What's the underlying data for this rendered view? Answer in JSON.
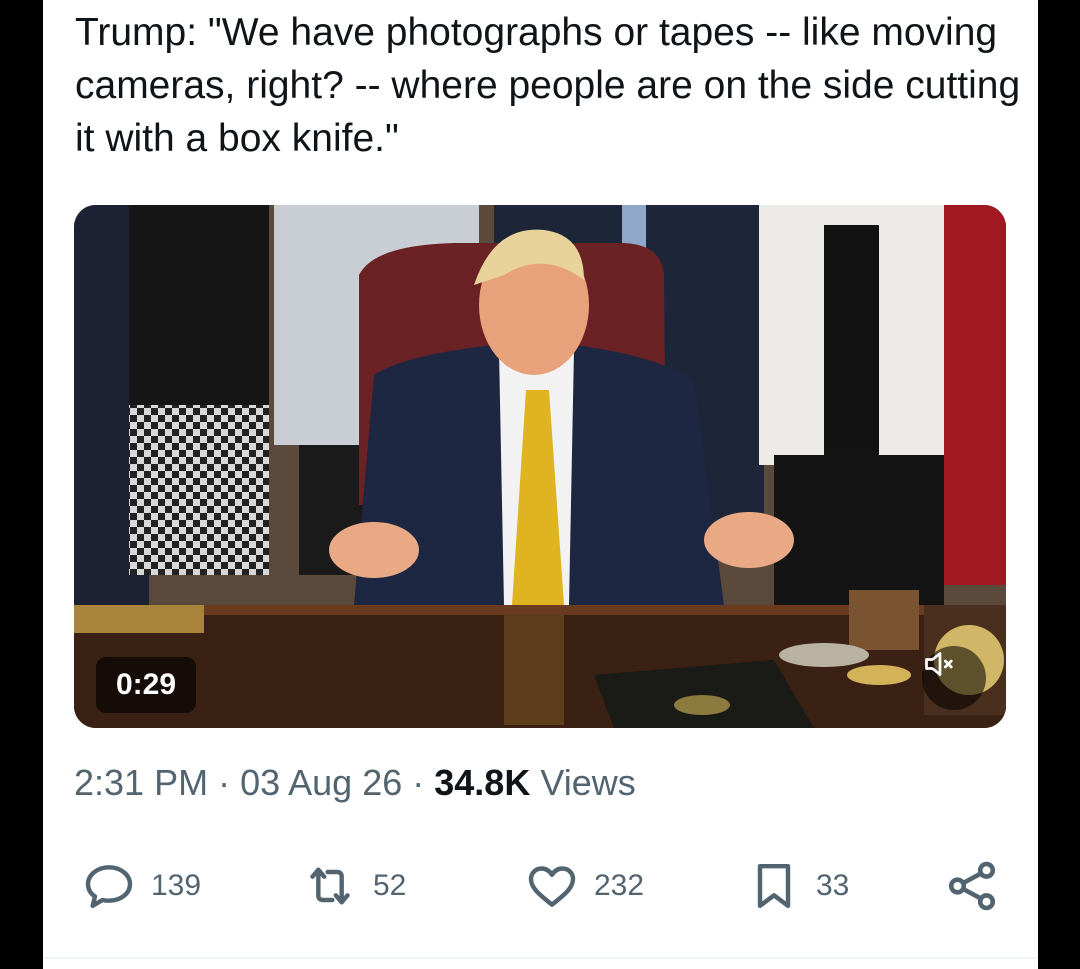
{
  "tweet": {
    "text": "Trump: \"We have photographs or tapes -- like moving cameras, right? -- where people are on the side cutting it with a box knife.\""
  },
  "media": {
    "duration": "0:29",
    "mute_icon": "speaker-muted-icon"
  },
  "meta": {
    "time": "2:31 PM",
    "sep1": " · ",
    "date": "03 Aug 26",
    "sep2": " · ",
    "views_count": "34.8K",
    "views_label": " Views"
  },
  "actions": {
    "replies": "139",
    "retweets": "52",
    "likes": "232",
    "bookmarks": "33"
  },
  "colors": {
    "text": "#0f1419",
    "secondary": "#536471",
    "background": "#ffffff"
  }
}
